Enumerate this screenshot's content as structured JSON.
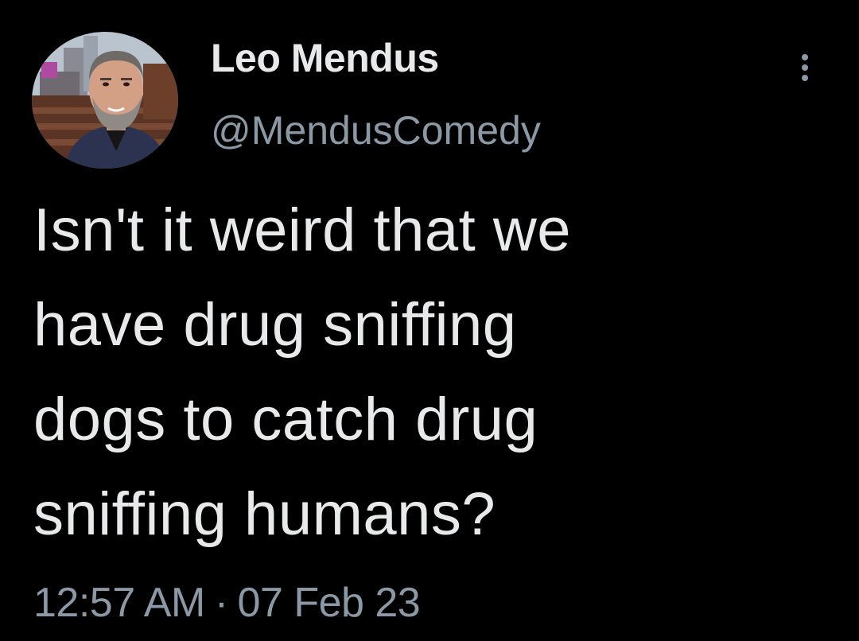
{
  "theme": {
    "background": "#000000",
    "primary_text": "#e7e9ea",
    "secondary_text": "#8b98a5"
  },
  "author": {
    "display_name": "Leo Mendus",
    "handle": "@MendusComedy",
    "avatar": "profile-photo"
  },
  "tweet": {
    "text_lines": [
      "Isn't it weird that we",
      "have drug sniffing",
      "dogs to catch drug",
      "sniffing humans?"
    ],
    "time": "12:57 AM",
    "separator": "·",
    "date": "07 Feb 23"
  },
  "actions": {
    "more_icon": "more-vertical-icon"
  }
}
